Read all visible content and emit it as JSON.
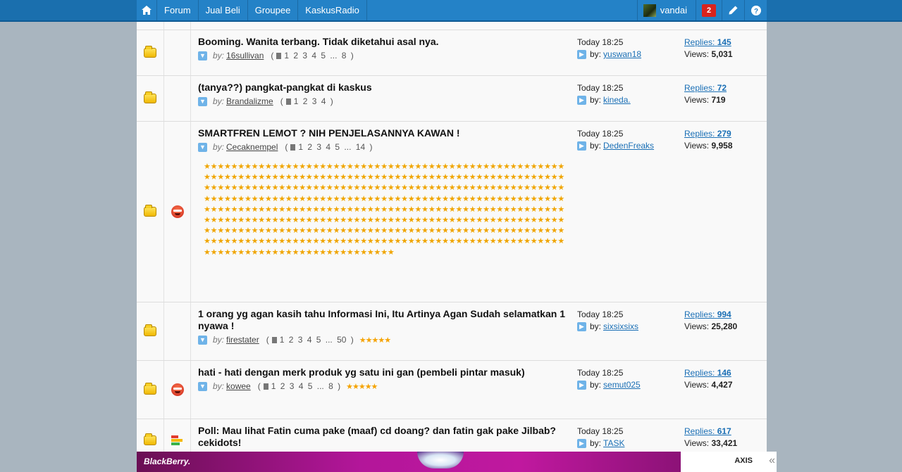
{
  "nav": {
    "items": [
      "Forum",
      "Jual Beli",
      "Groupee",
      "KaskusRadio"
    ],
    "username": "vandai",
    "notifications": "2"
  },
  "threads": [
    {
      "title": "Booming. Wanita terbang. Tidak diketahui asal nya.",
      "by": "by:",
      "author": "16sullivan",
      "pages": "1 2 3 4 5 ... 8",
      "last_time": "Today 18:25",
      "last_by_label": "by:",
      "last_by": "yuswan18",
      "replies_label": "Replies:",
      "replies": "145",
      "views_label": "Views:",
      "views": "5,031",
      "icon": "none",
      "rating": ""
    },
    {
      "title": "(tanya??) pangkat-pangkat di kaskus",
      "by": "by:",
      "author": "Brandalizme",
      "pages": "1 2 3 4",
      "last_time": "Today 18:25",
      "last_by_label": "by:",
      "last_by": "kineda.",
      "replies_label": "Replies:",
      "replies": "72",
      "views_label": "Views:",
      "views": "719",
      "icon": "none",
      "rating": ""
    },
    {
      "title": "SMARTFREN LEMOT ? NIH PENJELASANNYA KAWAN !",
      "by": "by:",
      "author": "Cecaknempel",
      "pages": "1 2 3 4 5 ... 14",
      "last_time": "Today 18:25",
      "last_by_label": "by:",
      "last_by": "DedenFreaks",
      "replies_label": "Replies:",
      "replies": "279",
      "views_label": "Views:",
      "views": "9,958",
      "icon": "smiley-icon",
      "rating": "",
      "star_spam_count": 452
    },
    {
      "title": "1 orang yg agan kasih tahu Informasi Ini, Itu Artinya Agan Sudah selamatkan 1 nyawa !",
      "by": "by:",
      "author": "firestater",
      "pages": "1 2 3 4 5 ... 50",
      "last_time": "Today 18:25",
      "last_by_label": "by:",
      "last_by": "sixsixsixs",
      "replies_label": "Replies:",
      "replies": "994",
      "views_label": "Views:",
      "views": "25,280",
      "icon": "none",
      "rating": "★★★★★"
    },
    {
      "title": "hati - hati dengan merk produk yg satu ini gan (pembeli pintar masuk)",
      "by": "by:",
      "author": "kowee",
      "pages": "1 2 3 4 5 ... 8",
      "last_time": "Today 18:25",
      "last_by_label": "by:",
      "last_by": "semut025",
      "replies_label": "Replies:",
      "replies": "146",
      "views_label": "Views:",
      "views": "4,427",
      "icon": "smiley-icon",
      "rating": "★★★★★"
    },
    {
      "title": "Poll: Mau lihat Fatin cuma pake (maaf) cd doang? dan fatin gak pake Jilbab? cekidots!",
      "by": "by:",
      "author": "",
      "pages": "",
      "last_time": "Today 18:25",
      "last_by_label": "by:",
      "last_by": "TASK",
      "replies_label": "Replies:",
      "replies": "617",
      "views_label": "Views:",
      "views": "33,421",
      "icon": "poll-icon",
      "rating": ""
    }
  ],
  "ad": {
    "brand": "BlackBerry.",
    "partner": "AXIS",
    "collapse": "«"
  },
  "colors": {
    "topbar": "#2482c7",
    "link": "#1a6fb5",
    "ad_magenta": "#b3169a"
  }
}
